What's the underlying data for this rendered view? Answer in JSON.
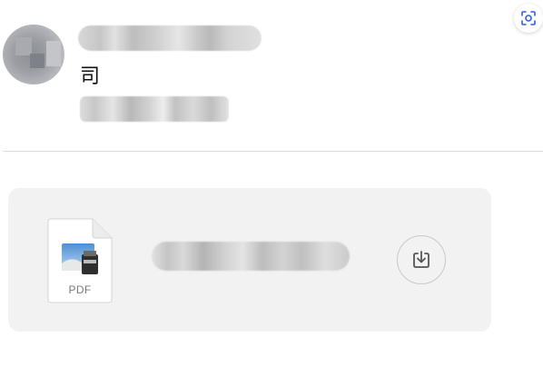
{
  "message": {
    "sender_name": "",
    "body_char": "司",
    "sub_line": ""
  },
  "icons": {
    "scan": "scan-icon",
    "download": "download-icon",
    "pdf": "pdf-file-icon"
  },
  "attachment": {
    "file_type_label": "PDF",
    "file_name": ""
  },
  "colors": {
    "card_background": "#f2f2f2",
    "divider": "#dcdcdc",
    "icon_stroke": "#555555"
  }
}
